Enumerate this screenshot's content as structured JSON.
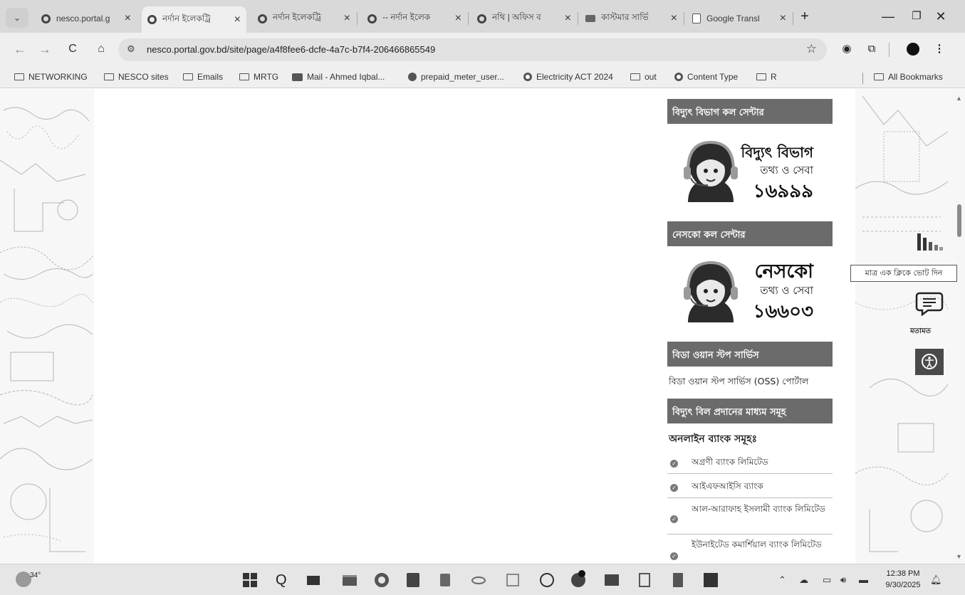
{
  "browser": {
    "tabs": [
      {
        "title": "nesco.portal.g",
        "active": false
      },
      {
        "title": "নর্দান ইলেকট্রি",
        "active": true
      },
      {
        "title": "নর্দান ইলেকট্রি",
        "active": false
      },
      {
        "title": "-- নর্দান ইলেক",
        "active": false
      },
      {
        "title": "নথি | অফিস ব",
        "active": false
      },
      {
        "title": "কাস্টমার সার্ভি",
        "active": false
      },
      {
        "title": "Google Transl",
        "active": false
      }
    ],
    "new_tab_label": "+",
    "url": "nesco.portal.gov.bd/site/page/a4f8fee6-dcfe-4a7c-b7f4-206466865549",
    "bookmarks": [
      {
        "label": "NETWORKING",
        "icon": "folder-icon"
      },
      {
        "label": "NESCO sites",
        "icon": "folder-icon"
      },
      {
        "label": "Emails",
        "icon": "folder-icon"
      },
      {
        "label": "MRTG",
        "icon": "folder-icon"
      },
      {
        "label": "Mail - Ahmed Iqbal...",
        "icon": "mail-icon"
      },
      {
        "label": "prepaid_meter_user...",
        "icon": "globe-icon"
      },
      {
        "label": "Electricity ACT 2024",
        "icon": "site-icon"
      },
      {
        "label": "out",
        "icon": "folder-icon"
      },
      {
        "label": "Content Type",
        "icon": "site-icon"
      },
      {
        "label": "R",
        "icon": "folder-icon"
      }
    ],
    "all_bookmarks": "All Bookmarks"
  },
  "sidebar": {
    "power_call_center_heading": "বিদ্যুৎ বিভাগ কল সেন্টার",
    "power_card": {
      "title": "বিদ্যুৎ বিভাগ",
      "subtitle": "তথ্য ও সেবা",
      "number": "১৬৯৯৯"
    },
    "nesco_call_center_heading": "নেসকো কল সেন্টার",
    "nesco_card": {
      "title": "নেসকো",
      "subtitle": "তথ্য ও সেবা",
      "number": "১৬৬০৩"
    },
    "bida_heading": "বিডা ওয়ান স্টপ সার্ভিস",
    "bida_link": "বিডা ওয়ান স্টপ সার্ভিস (OSS) পোর্টাল",
    "bill_heading": "বিদ্যুৎ বিল প্রদানের মাধ্যম সমূহ",
    "online_banks_title": "অনলাইন ব্যাংক সমূহঃ",
    "banks": [
      "অগ্রণী ব্যাংক লিমিটেড",
      "আইএফআইসি ব্যাংক",
      "আল-আরাফাহ ইসলামী ব্যাংক লিমিটেড",
      "ইউনাইটেড কমার্শিয়াল ব্যাংক লিমিটেড"
    ]
  },
  "floating": {
    "vote_tooltip": "মাত্র এক ক্লিকে ভোট দিন",
    "feedback_label": "মতামত"
  },
  "taskbar": {
    "weather": "34°",
    "time": "12:38 PM",
    "date": "9/30/2025"
  }
}
